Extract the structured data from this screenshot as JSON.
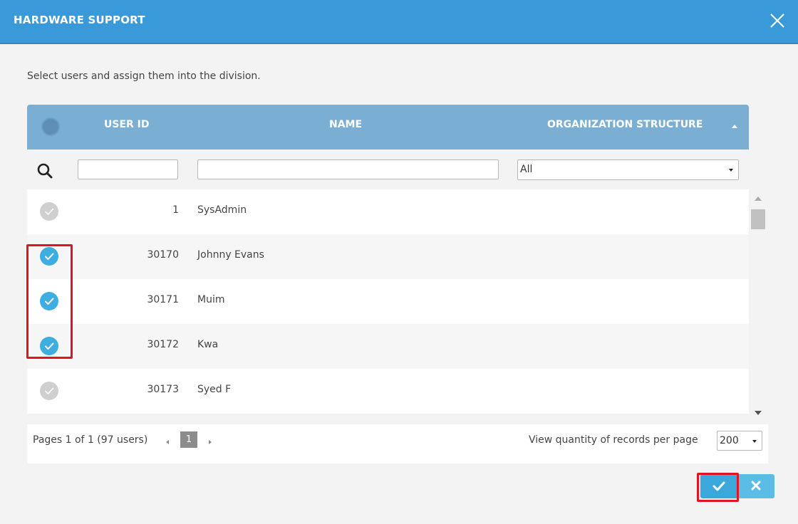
{
  "dialog": {
    "title": "HARDWARE SUPPORT",
    "instructions": "Select users and assign them into the division."
  },
  "table": {
    "columns": [
      {
        "key": "user_id",
        "label": "USER ID"
      },
      {
        "key": "name",
        "label": "NAME"
      },
      {
        "key": "org",
        "label": "ORGANIZATION STRUCTURE"
      }
    ],
    "filters": {
      "user_id_value": "",
      "name_value": "",
      "org_selected": "All"
    },
    "rows": [
      {
        "id": "1",
        "name": "SysAdmin",
        "selected": false
      },
      {
        "id": "30170",
        "name": "Johnny Evans",
        "selected": true
      },
      {
        "id": "30171",
        "name": "Muim",
        "selected": true
      },
      {
        "id": "30172",
        "name": "Kwa",
        "selected": true
      },
      {
        "id": "30173",
        "name": "Syed F",
        "selected": false
      }
    ]
  },
  "pagination": {
    "summary": "Pages 1 of 1 (97 users)",
    "current_page": "1",
    "per_page_label": "View quantity of records per page",
    "per_page_value": "200"
  },
  "colors": {
    "header_bar": "#3a9ad9",
    "table_header": "#7aafd3",
    "checked": "#3eaee0",
    "unchecked": "#cfcfcf",
    "highlight": "#e11426"
  },
  "icons": [
    "close-icon",
    "search-icon",
    "check-icon",
    "x-icon",
    "sort-up-icon",
    "dropdown-caret-icon"
  ]
}
